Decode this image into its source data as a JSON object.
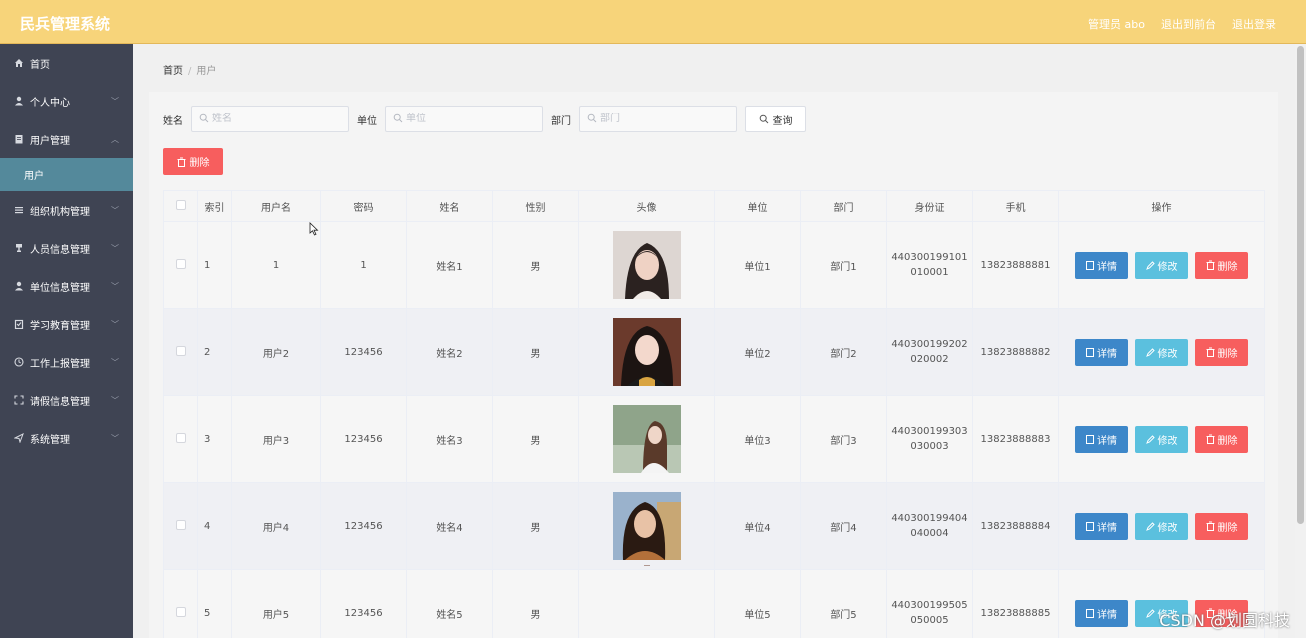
{
  "app": {
    "title": "民兵管理系统",
    "admin_label": "管理员 abo",
    "exit_to_front": "退出到前台",
    "logout": "退出登录"
  },
  "sidebar": {
    "items": [
      {
        "label": "首页",
        "icon": "home-icon"
      },
      {
        "label": "个人中心",
        "icon": "user-icon"
      },
      {
        "label": "用户管理",
        "icon": "document-icon"
      },
      {
        "label": "用户",
        "icon": ""
      },
      {
        "label": "组织机构管理",
        "icon": "menu-icon"
      },
      {
        "label": "人员信息管理",
        "icon": "trophy-icon"
      },
      {
        "label": "单位信息管理",
        "icon": "user-icon"
      },
      {
        "label": "学习教育管理",
        "icon": "clipboard-icon"
      },
      {
        "label": "工作上报管理",
        "icon": "clock-icon"
      },
      {
        "label": "请假信息管理",
        "icon": "fullscreen-icon"
      },
      {
        "label": "系统管理",
        "icon": "send-icon"
      }
    ]
  },
  "breadcrumb": {
    "home": "首页",
    "separator": "/",
    "current": "用户"
  },
  "filters": {
    "name_label": "姓名",
    "name_placeholder": "姓名",
    "unit_label": "单位",
    "unit_placeholder": "单位",
    "dept_label": "部门",
    "dept_placeholder": "部门",
    "query_button": "查询"
  },
  "bulk_delete": "删除",
  "table": {
    "headers": [
      "索引",
      "用户名",
      "密码",
      "姓名",
      "性别",
      "头像",
      "单位",
      "部门",
      "身份证",
      "手机",
      "操作"
    ],
    "rows": [
      {
        "index": "1",
        "username": "1",
        "password": "1",
        "name": "姓名1",
        "gender": "男",
        "unit": "单位1",
        "dept": "部门1",
        "id1": "440300199101",
        "id2": "010001",
        "phone": "13823888881"
      },
      {
        "index": "2",
        "username": "用户2",
        "password": "123456",
        "name": "姓名2",
        "gender": "男",
        "unit": "单位2",
        "dept": "部门2",
        "id1": "440300199202",
        "id2": "020002",
        "phone": "13823888882"
      },
      {
        "index": "3",
        "username": "用户3",
        "password": "123456",
        "name": "姓名3",
        "gender": "男",
        "unit": "单位3",
        "dept": "部门3",
        "id1": "440300199303",
        "id2": "030003",
        "phone": "13823888883"
      },
      {
        "index": "4",
        "username": "用户4",
        "password": "123456",
        "name": "姓名4",
        "gender": "男",
        "unit": "单位4",
        "dept": "部门4",
        "id1": "440300199404",
        "id2": "040004",
        "phone": "13823888884"
      },
      {
        "index": "5",
        "username": "用户5",
        "password": "123456",
        "name": "姓名5",
        "gender": "男",
        "unit": "单位5",
        "dept": "部门5",
        "id1": "440300199505",
        "id2": "050005",
        "phone": "13823888885"
      }
    ],
    "actions": {
      "detail": "详情",
      "edit": "修改",
      "delete": "删除"
    }
  },
  "watermark": "CSDN @划圆科技",
  "colors": {
    "header": "#f7d47a",
    "sidebar": "#3f4453",
    "sidebar_active": "#54899b",
    "btn_detail": "#3d87c9",
    "btn_edit": "#5bc0de",
    "btn_delete": "#f75e5e"
  }
}
